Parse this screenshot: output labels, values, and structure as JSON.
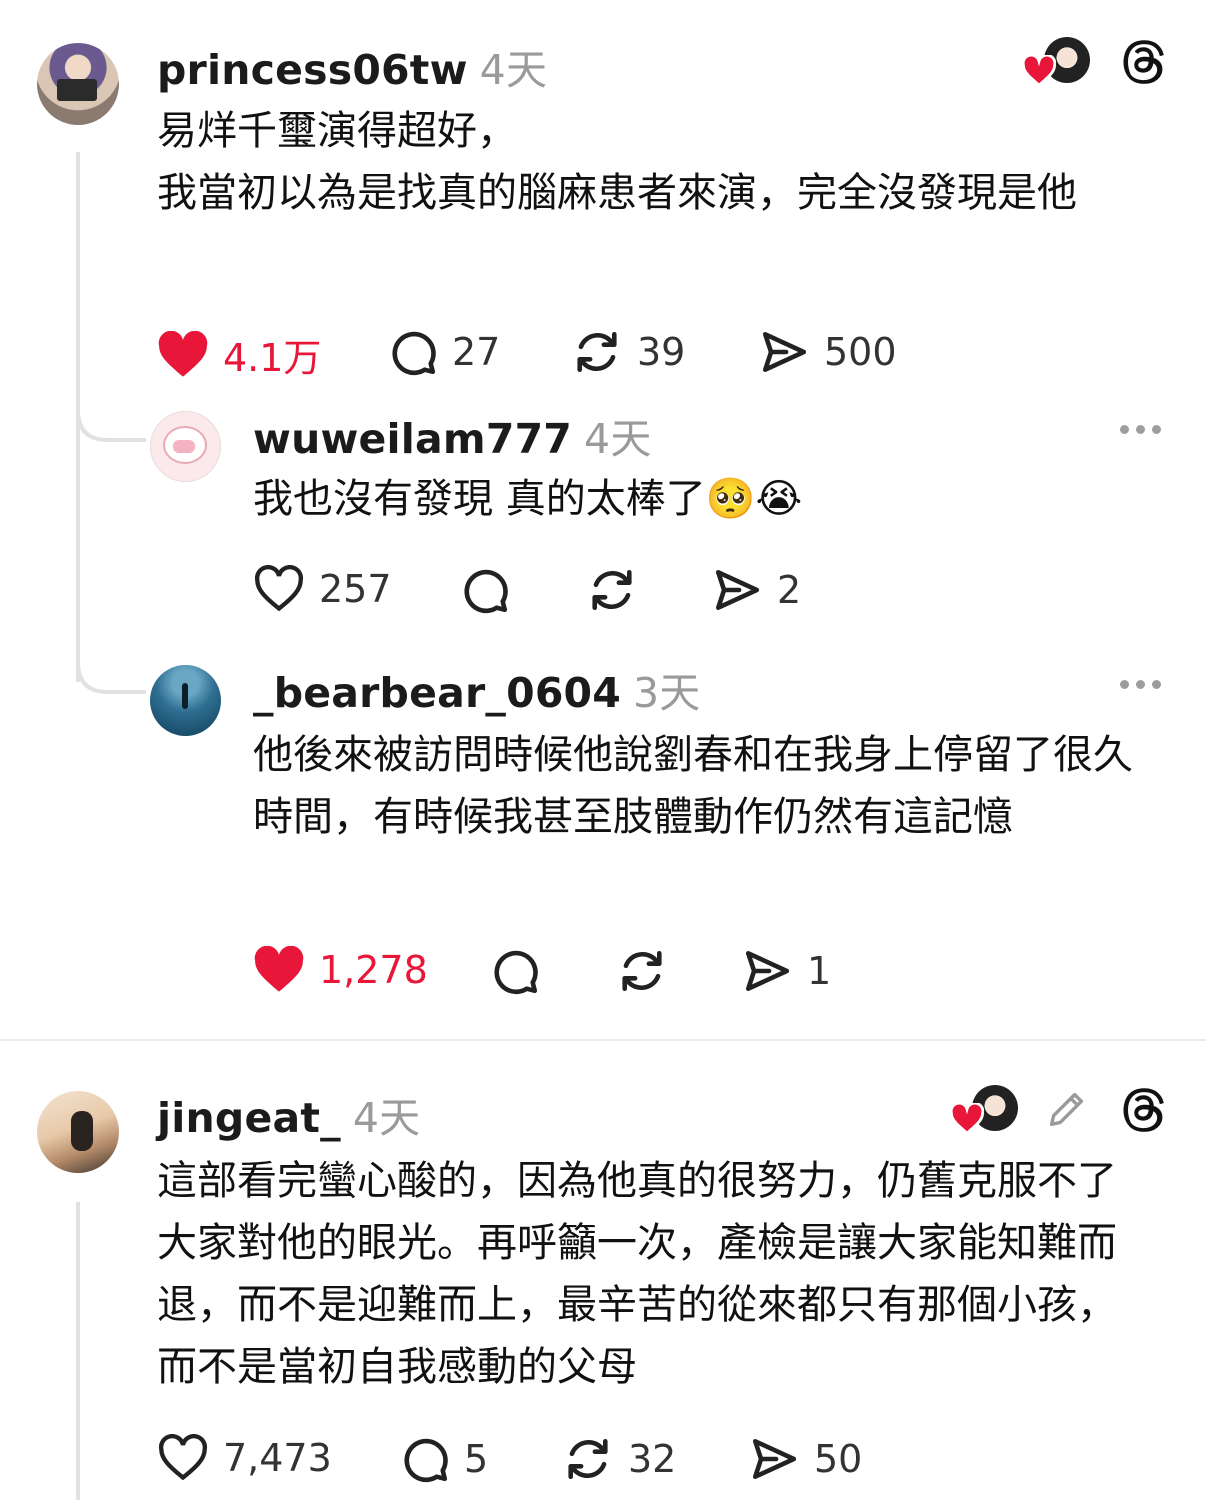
{
  "posts": [
    {
      "username": "princess06tw",
      "time": "4天",
      "text": "易烊千璽演得超好，\n我當初以為是找真的腦麻患者來演，完全沒發現是他",
      "likes": "4.1万",
      "comments": "27",
      "reposts": "39",
      "shares": "500",
      "liked": true
    },
    {
      "username": "wuweilam777",
      "time": "4天",
      "text": "我也沒有發現 真的太棒了🥺😭",
      "likes": "257",
      "comments": "",
      "reposts": "",
      "shares": "2",
      "liked": false
    },
    {
      "username": "_bearbear_0604",
      "time": "3天",
      "text": "他後來被訪問時候他說劉春和在我身上停留了很久時間，有時候我甚至肢體動作仍然有這記憶",
      "likes": "1,278",
      "comments": "",
      "reposts": "",
      "shares": "1",
      "liked": true
    },
    {
      "username": "jingeat_",
      "time": "4天",
      "text": "這部看完蠻心酸的，因為他真的很努力，仍舊克服不了大家對他的眼光。再呼籲一次，產檢是讓大家能知難而退，而不是迎難而上，最辛苦的從來都只有那個小孩，而不是當初自我感動的父母",
      "likes": "7,473",
      "comments": "5",
      "reposts": "32",
      "shares": "50",
      "liked": false
    }
  ],
  "colors": {
    "accent_like": "#e8173a",
    "text": "#111111",
    "muted": "#9a9a9a",
    "thread_line": "#e1e1e1"
  },
  "icons": [
    "heart-icon",
    "comment-icon",
    "repost-icon",
    "share-icon",
    "threads-logo-icon",
    "more-icon",
    "edit-icon"
  ]
}
